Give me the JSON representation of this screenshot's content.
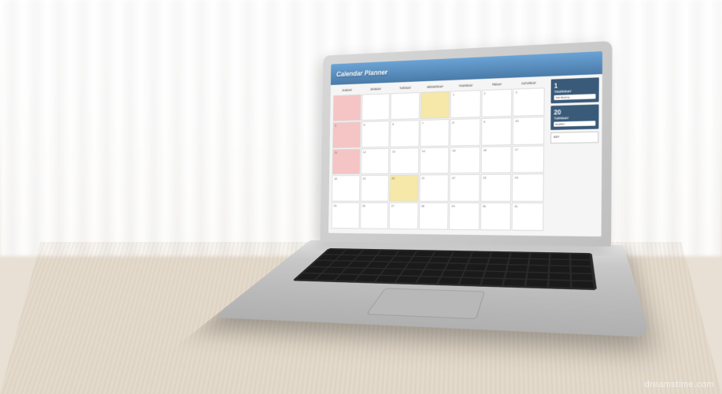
{
  "app": {
    "title": "Calendar Planner"
  },
  "calendar": {
    "day_headers": [
      "SUNDAY",
      "MONDAY",
      "TUESDAY",
      "WEDNESDAY",
      "THURSDAY",
      "FRIDAY",
      "SATURDAY"
    ],
    "cells": [
      {
        "num": "",
        "color": "pink"
      },
      {
        "num": "",
        "color": ""
      },
      {
        "num": "",
        "color": ""
      },
      {
        "num": "",
        "color": "yellow"
      },
      {
        "num": "1",
        "color": ""
      },
      {
        "num": "2",
        "color": ""
      },
      {
        "num": "3",
        "color": ""
      },
      {
        "num": "4",
        "color": "pink"
      },
      {
        "num": "5",
        "color": ""
      },
      {
        "num": "6",
        "color": ""
      },
      {
        "num": "7",
        "color": ""
      },
      {
        "num": "8",
        "color": ""
      },
      {
        "num": "9",
        "color": ""
      },
      {
        "num": "10",
        "color": ""
      },
      {
        "num": "11",
        "color": "pink"
      },
      {
        "num": "12",
        "color": ""
      },
      {
        "num": "13",
        "color": ""
      },
      {
        "num": "14",
        "color": ""
      },
      {
        "num": "15",
        "color": ""
      },
      {
        "num": "16",
        "color": ""
      },
      {
        "num": "17",
        "color": ""
      },
      {
        "num": "18",
        "color": ""
      },
      {
        "num": "19",
        "color": ""
      },
      {
        "num": "20",
        "color": "yellow"
      },
      {
        "num": "21",
        "color": ""
      },
      {
        "num": "22",
        "color": ""
      },
      {
        "num": "23",
        "color": ""
      },
      {
        "num": "24",
        "color": ""
      },
      {
        "num": "25",
        "color": ""
      },
      {
        "num": "26",
        "color": ""
      },
      {
        "num": "27",
        "color": ""
      },
      {
        "num": "28",
        "color": ""
      },
      {
        "num": "29",
        "color": ""
      },
      {
        "num": "30",
        "color": ""
      },
      {
        "num": "31",
        "color": ""
      }
    ]
  },
  "sidebar": {
    "panel1": {
      "date": "1",
      "day": "THURSDAY",
      "event_time": "9:00",
      "event_label": "Meeting"
    },
    "panel2": {
      "date": "20",
      "day": "TUESDAY",
      "event_label": "Deadline"
    },
    "key": {
      "title": "KEY"
    }
  },
  "watermark": "dreamstime.com"
}
